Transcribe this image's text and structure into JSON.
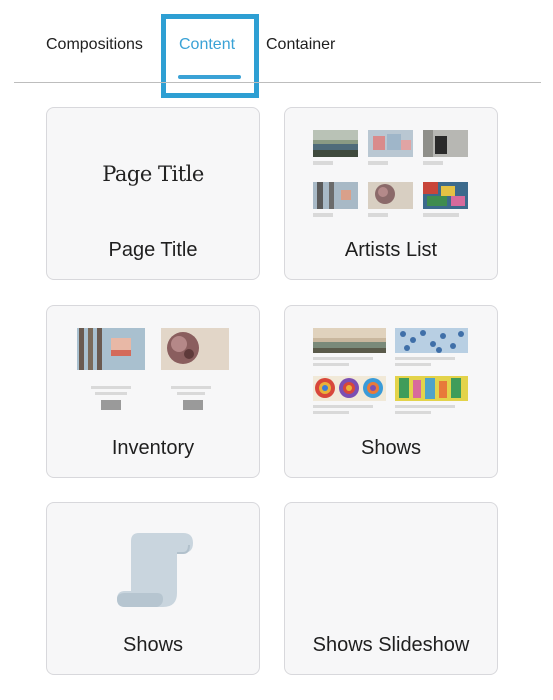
{
  "tabs": {
    "items": [
      {
        "label": "Compositions",
        "active": false
      },
      {
        "label": "Content",
        "active": true
      },
      {
        "label": "Container",
        "active": false
      }
    ],
    "accent_color": "#3aa2d6"
  },
  "cards": [
    {
      "label": "Page Title",
      "preview_text": "Page Title"
    },
    {
      "label": "Artists List"
    },
    {
      "label": "Inventory"
    },
    {
      "label": "Shows"
    },
    {
      "label": "Shows",
      "icon": "scroll-icon"
    },
    {
      "label": "Shows Slideshow"
    }
  ]
}
